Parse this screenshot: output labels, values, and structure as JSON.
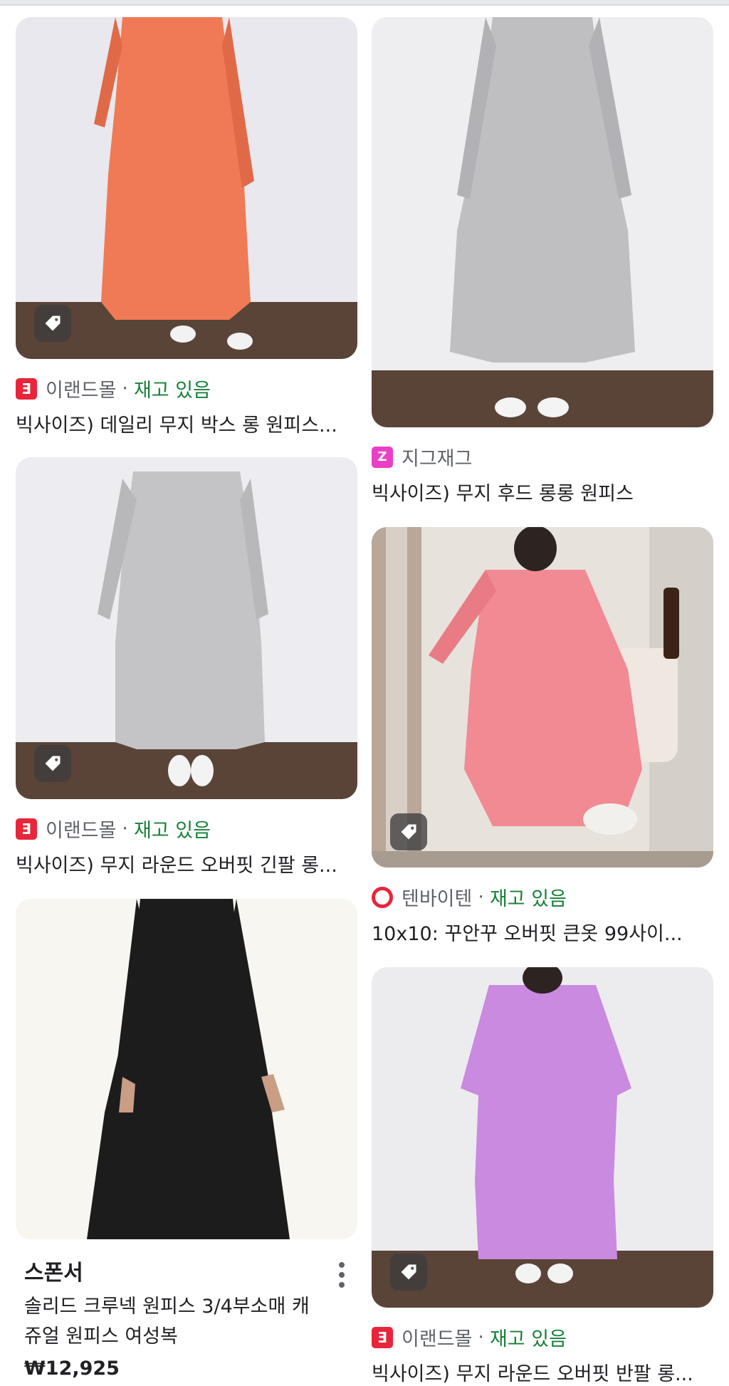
{
  "results": [
    {
      "store": "이랜드몰",
      "separator": "·",
      "availability": "재고 있음",
      "title": "빅사이즈) 데일리 무지 박스 롱 원피스...",
      "logo_glyph": "Ǝ",
      "logo_color": "#e8253a",
      "dress_color": "#f07a55"
    },
    {
      "store": "지그재그",
      "availability": "",
      "title": "빅사이즈) 무지 후드 롱롱 원피스",
      "logo_glyph": "Z",
      "logo_color": "#ea3fc6",
      "dress_color": "#bfbfc2"
    },
    {
      "store": "이랜드몰",
      "separator": "·",
      "availability": "재고 있음",
      "title": "빅사이즈) 무지 라운드 오버핏 긴팔 롱...",
      "logo_glyph": "Ǝ",
      "logo_color": "#e8253a",
      "dress_color": "#c4c4c6"
    },
    {
      "store": "텐바이텐",
      "separator": "·",
      "availability": "재고 있음",
      "title": "10x10: 꾸안꾸 오버핏 큰옷 99사이...",
      "logo_glyph": "",
      "logo_color": "#e8253a",
      "dress_color": "#f18a92"
    },
    {
      "store": "이랜드몰",
      "separator": "·",
      "availability": "재고 있음",
      "title": "빅사이즈) 무지 라운드 오버핏 반팔 롱...",
      "logo_glyph": "Ǝ",
      "logo_color": "#e8253a",
      "dress_color": "#c98ae0"
    }
  ],
  "sponsored": {
    "label": "스폰서",
    "title": "솔리드 크루넥 원피스 3/4부소매 캐쥬얼 원피스 여성복",
    "price": "₩12,925",
    "dress_color": "#1c1c1c"
  },
  "icons": {
    "tag": "tag-icon",
    "more": "more-vert-icon"
  }
}
